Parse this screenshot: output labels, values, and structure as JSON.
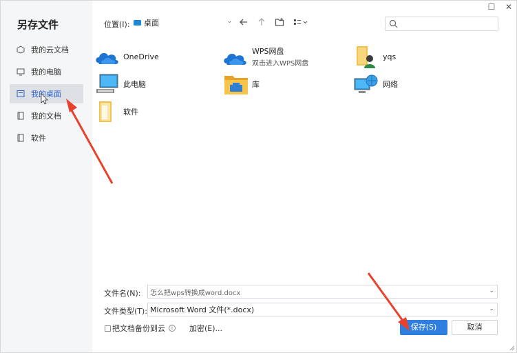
{
  "dialog": {
    "title": "另存文件",
    "window_controls": {
      "maximize": "☐",
      "close": "✕"
    }
  },
  "sidebar": {
    "items": [
      {
        "label": "我的云文档",
        "icon": "cloud-doc-icon",
        "active": false
      },
      {
        "label": "我的电脑",
        "icon": "computer-icon",
        "active": false
      },
      {
        "label": "我的桌面",
        "icon": "desktop-icon",
        "active": true
      },
      {
        "label": "我的文档",
        "icon": "documents-icon",
        "active": false
      },
      {
        "label": "软件",
        "icon": "folder-icon",
        "active": false
      }
    ]
  },
  "toolbar": {
    "location_label": "位置(I):",
    "location_value": "桌面",
    "search_placeholder": ""
  },
  "files": [
    {
      "name": "OneDrive",
      "sub": "",
      "icon": "onedrive-cloud-icon"
    },
    {
      "name": "WPS网盘",
      "sub": "双击进入WPS网盘",
      "icon": "wps-cloud-icon"
    },
    {
      "name": "yqs",
      "sub": "",
      "icon": "user-folder-icon"
    },
    {
      "name": "此电脑",
      "sub": "",
      "icon": "this-pc-icon"
    },
    {
      "name": "库",
      "sub": "",
      "icon": "library-folder-icon"
    },
    {
      "name": "网络",
      "sub": "",
      "icon": "network-icon"
    },
    {
      "name": "软件",
      "sub": "",
      "icon": "folder-icon"
    }
  ],
  "form": {
    "filename_label": "文件名(N):",
    "filename_value": "怎么把wps转换成word.docx",
    "filetype_label": "文件类型(T):",
    "filetype_value": "Microsoft Word 文件(*.docx)",
    "backup_label": "把文档备份到云",
    "encrypt_label": "加密(E)...",
    "save_label": "保存(S)",
    "cancel_label": "取消"
  },
  "colors": {
    "accent": "#2f7fe0",
    "sidebar_bg": "#f5f6f7",
    "active_bg": "#dde1e6",
    "annotation_arrow": "#e8412c"
  }
}
